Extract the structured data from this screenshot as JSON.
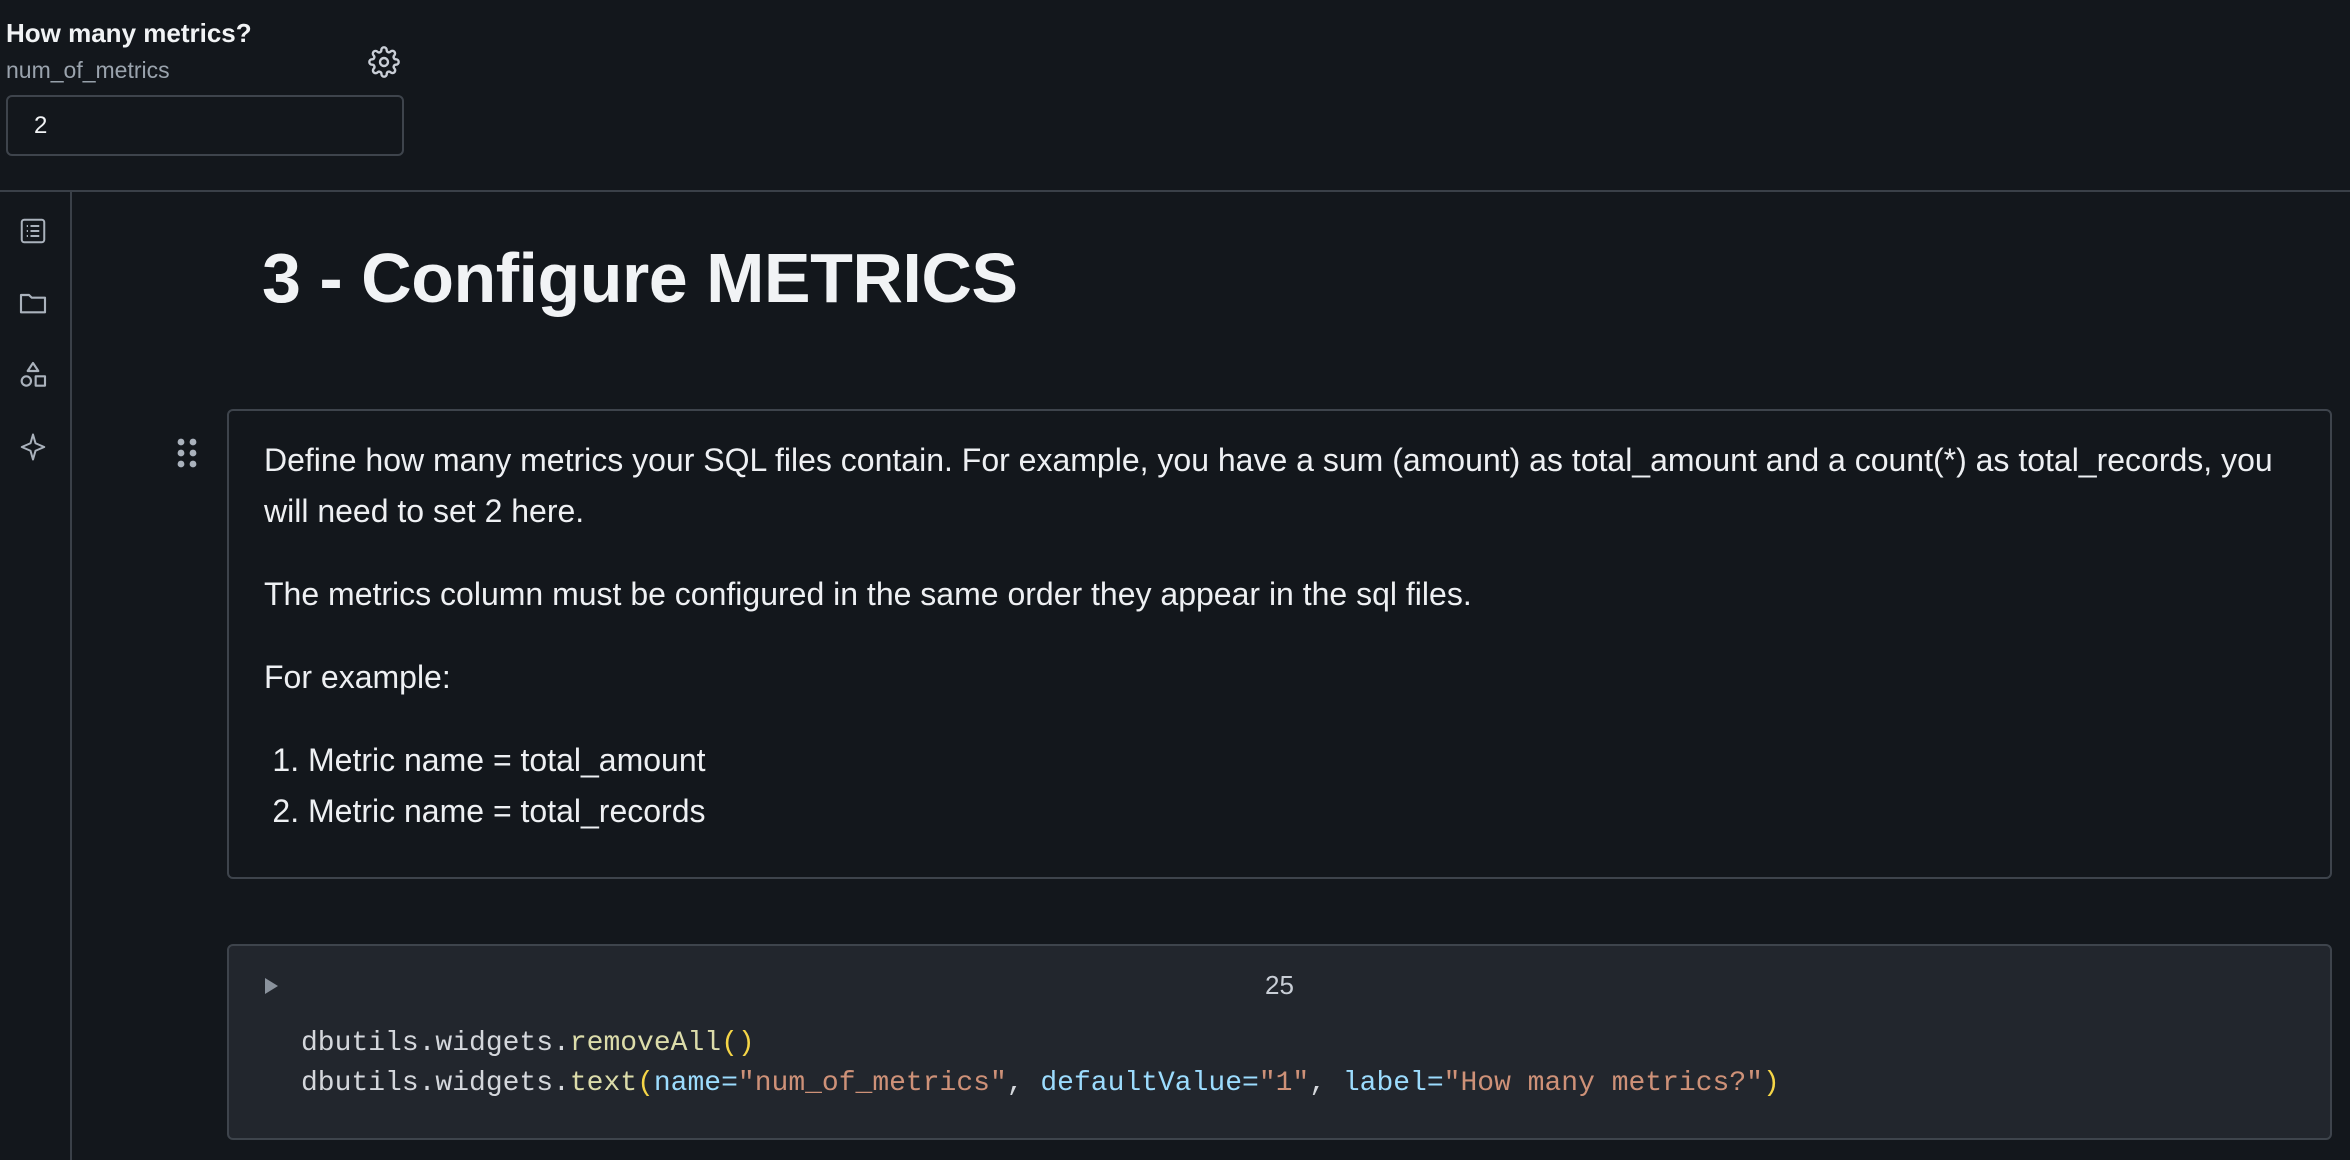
{
  "widget": {
    "label": "How many metrics?",
    "name": "num_of_metrics",
    "value": "2"
  },
  "sidebar": {
    "icons": [
      "table-of-contents-icon",
      "folder-icon",
      "shapes-icon",
      "sparkle-icon"
    ]
  },
  "notebook": {
    "title": "3 - Configure METRICS",
    "markdown": {
      "paragraph1": "Define how many metrics your SQL files contain. For example, you have a sum (amount) as total_amount and a count(*) as total_records, you will need to set 2 here.",
      "paragraph2": "The metrics column must be configured in the same order they appear in the sql files.",
      "paragraph3": "For example:",
      "list": [
        "Metric name = total_amount",
        "Metric name = total_records"
      ]
    },
    "code_cell": {
      "execution_count": "25",
      "line1": {
        "obj": "dbutils.widgets.",
        "fn": "removeAll",
        "open": "(",
        "close": ")"
      },
      "line2": {
        "obj": "dbutils.widgets.",
        "fn": "text",
        "open": "(",
        "arg1_key": "name",
        "eq": "=",
        "arg1_val": "\"num_of_metrics\"",
        "sep": ", ",
        "arg2_key": "defaultValue",
        "arg2_val": "\"1\"",
        "arg3_key": "label",
        "arg3_val": "\"How many metrics?\"",
        "close": ")"
      }
    }
  },
  "colors": {
    "background": "#13171c",
    "code_background": "#22262d",
    "border": "#3e444c",
    "string": "#ce9178",
    "keyword": "#9cdcfe",
    "paren": "#f5d547"
  }
}
